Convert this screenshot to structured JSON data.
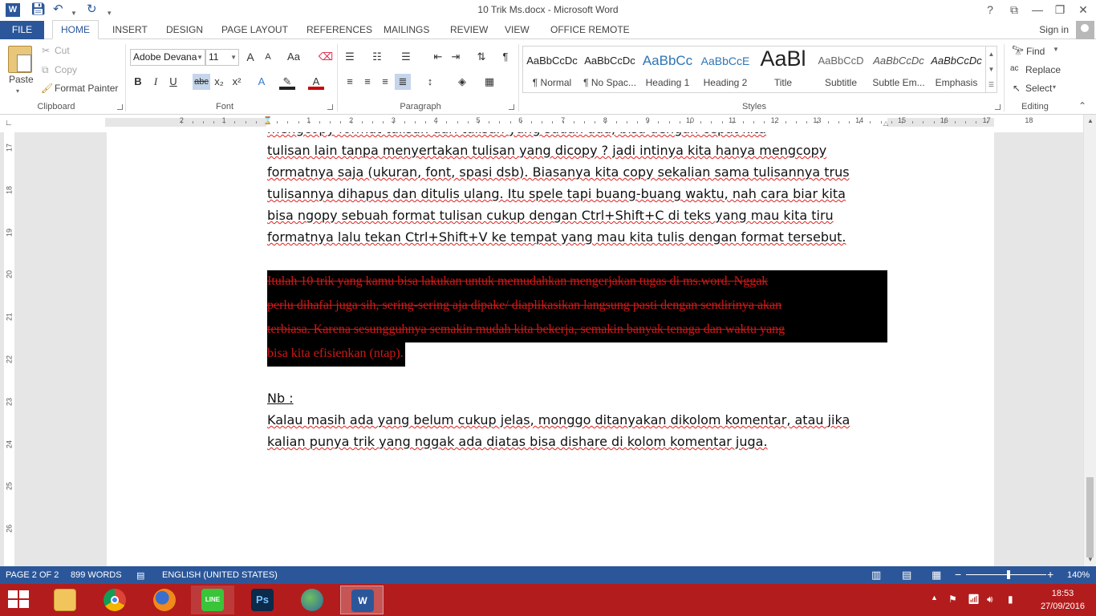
{
  "window": {
    "title": "10 Trik Ms.docx - Microsoft Word",
    "app_icon": "W",
    "controls": [
      "?",
      "⧉",
      "—",
      "❐",
      "✕"
    ]
  },
  "qat": {
    "save": "save-icon",
    "undo": "undo-icon",
    "redo": "redo-icon"
  },
  "tabs": {
    "file": "FILE",
    "items": [
      "HOME",
      "INSERT",
      "DESIGN",
      "PAGE LAYOUT",
      "REFERENCES",
      "MAILINGS",
      "REVIEW",
      "VIEW",
      "OFFICE REMOTE"
    ],
    "active": "HOME",
    "signin": "Sign in"
  },
  "clipboard": {
    "paste": "Paste",
    "cut": "Cut",
    "copy": "Copy",
    "format_painter": "Format Painter",
    "label": "Clipboard"
  },
  "font": {
    "family": "Adobe Devana",
    "size": "11",
    "bold": "B",
    "italic": "I",
    "underline": "U",
    "strike": "abc",
    "subscript": "x₂",
    "superscript": "x²",
    "grow": "A",
    "shrink": "A",
    "case": "Aa",
    "color_a": "A",
    "effects_a": "A",
    "label": "Font"
  },
  "paragraph": {
    "label": "Paragraph",
    "pilcrow": "¶"
  },
  "styles": {
    "label": "Styles",
    "items": [
      {
        "sample": "AaBbCcDc",
        "name": "¶ Normal"
      },
      {
        "sample": "AaBbCcDc",
        "name": "¶ No Spac..."
      },
      {
        "sample": "AaBbCc",
        "name": "Heading 1"
      },
      {
        "sample": "AaBbCcE",
        "name": "Heading 2"
      },
      {
        "sample": "AaBl",
        "name": "Title"
      },
      {
        "sample": "AaBbCcD",
        "name": "Subtitle"
      },
      {
        "sample": "AaBbCcDc",
        "name": "Subtle Em..."
      },
      {
        "sample": "AaBbCcDc",
        "name": "Emphasis"
      }
    ]
  },
  "editing": {
    "find": "Find",
    "replace": "Replace",
    "select": "Select",
    "label": "Editing"
  },
  "ruler": {
    "marks": [
      "2",
      "1",
      "1",
      "2",
      "3",
      "4",
      "5",
      "6",
      "7",
      "8",
      "9",
      "10",
      "11",
      "12",
      "13",
      "14",
      "15",
      "16",
      "17",
      "18"
    ],
    "vmarks": [
      "17",
      "18",
      "19",
      "20",
      "21",
      "22",
      "23",
      "24",
      "25",
      "26"
    ]
  },
  "document": {
    "para1": [
      "tulisan lain tanpa menyertakan tulisan yang dicopy ? jadi intinya kita hanya mengcopy",
      "formatnya saja (ukuran, font, spasi dsb). Biasanya kita copy sekalian sama tulisannya trus",
      "tulisannya dihapus dan ditulis ulang. Itu spele tapi buang-buang waktu, nah cara biar kita",
      "bisa ngopy sebuah format tulisan cukup dengan Ctrl+Shift+C di teks yang mau kita tiru",
      "formatnya lalu tekan Ctrl+Shift+V ke tempat yang mau kita tulis dengan format tersebut."
    ],
    "highlight": [
      "Itulah 10 trik yang kamu bisa lakukan untuk memudahkan mengerjakan tugas di ms.word. Nggak",
      "perlu dihafal juga sih, sering-sering aja dipake/ diaplikasikan langsung pasti dengan sendirinya akan",
      "terbiasa. Karena sesungguhnya semakin mudah kita bekerja, semakin banyak tenaga dan waktu yang",
      "bisa kita efisienkan (ntap)."
    ],
    "nb": "Nb :",
    "para2": [
      "Kalau masih ada yang belum cukup jelas, monggo ditanyakan dikolom komentar, atau jika",
      "kalian punya trik yang nggak ada diatas bisa dishare di kolom komentar juga."
    ]
  },
  "status": {
    "page": "PAGE 2 OF 2",
    "words": "899 WORDS",
    "language": "ENGLISH (UNITED STATES)",
    "zoom": "140%",
    "zoom_minus": "−",
    "zoom_plus": "+"
  },
  "taskbar": {
    "apps": [
      "file-explorer-icon",
      "chrome-icon",
      "firefox-icon",
      "line-icon",
      "photoshop-icon",
      "globe-icon",
      "word-icon"
    ],
    "line_label": "LINE",
    "ps_label": "Ps",
    "time": "18:53",
    "date": "27/09/2016"
  },
  "colors": {
    "word_blue": "#2b579a",
    "taskbar_red": "#b31c1c",
    "highlight_text": "#d01818"
  }
}
